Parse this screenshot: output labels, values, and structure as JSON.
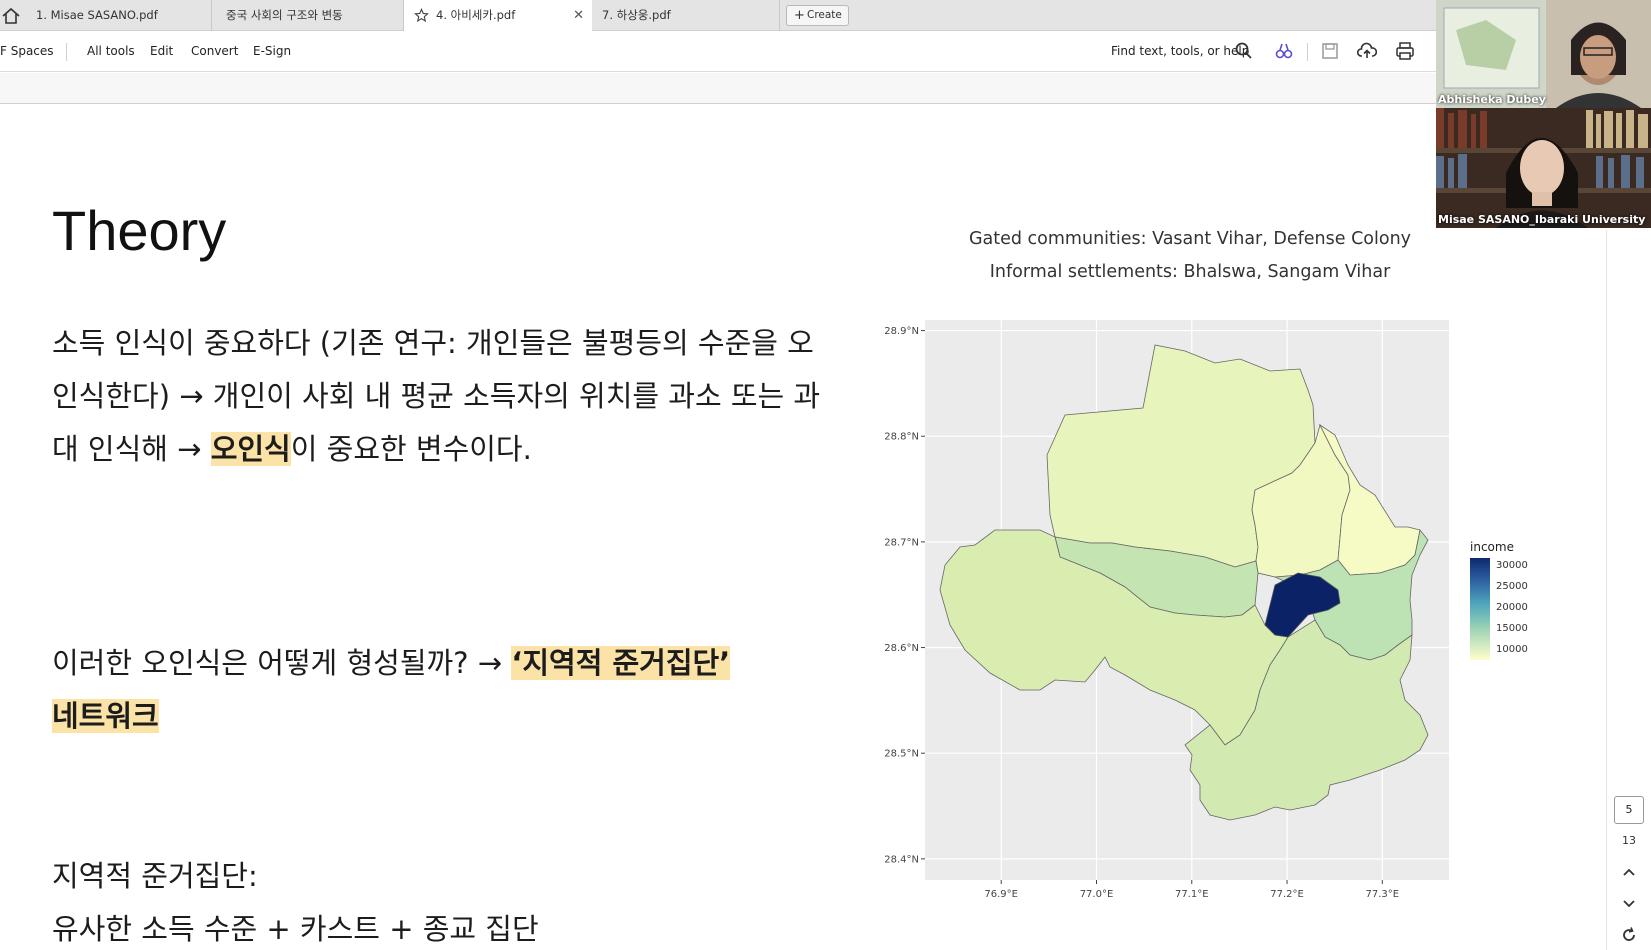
{
  "tabs": [
    {
      "label": "1. Misae SASANO.pdf",
      "active": false
    },
    {
      "label": "중국 사회의 구조와 변동",
      "active": false
    },
    {
      "label": "4. 아비세카.pdf",
      "active": true
    },
    {
      "label": "7. 하상웅.pdf",
      "active": false
    }
  ],
  "create_label": "Create",
  "toolbar": {
    "spaces": "F Spaces",
    "all_tools": "All tools",
    "edit": "Edit",
    "convert": "Convert",
    "esign": "E-Sign",
    "search_label": "Find text, tools, or help"
  },
  "slide": {
    "title": "Theory",
    "p1": {
      "a": "소득 인식이 중요하다 (기존 연구: 개인들은 불평등의 수준을 오인식한다) → 개인이 사회 내 평균 소득자의 위치를 과소 또는 과대 인식해 → ",
      "hl": "오인식",
      "b": "이 중요한 변수이다."
    },
    "p2": {
      "a": "이러한 오인식은 어떻게 형성될까? → ",
      "hl1": "‘지역적 준거집단’",
      "hl2": "네트워크"
    },
    "p3": {
      "l1": "지역적 준거집단:",
      "l2": "유사한 소득 수준 + 카스트 + 종교 집단"
    },
    "caption1": "Gated communities: Vasant Vihar, Defense Colony",
    "caption2": "Informal settlements: Bhalswa, Sangam Vihar"
  },
  "chart_data": {
    "type": "choropleth",
    "y_ticks": [
      "28.9°N",
      "28.8°N",
      "28.7°N",
      "28.6°N",
      "28.5°N",
      "28.4°N"
    ],
    "x_ticks": [
      "76.9°E",
      "77.0°E",
      "77.1°E",
      "77.2°E",
      "77.3°E"
    ],
    "y_values": [
      28.9,
      28.8,
      28.7,
      28.6,
      28.5,
      28.4
    ],
    "x_values": [
      76.9,
      77.0,
      77.1,
      77.2,
      77.3
    ],
    "xlim": [
      76.82,
      77.37
    ],
    "ylim": [
      28.38,
      28.91
    ],
    "legend_title": "income",
    "legend_ticks": [
      "30000",
      "25000",
      "20000",
      "15000",
      "10000"
    ],
    "legend_values": [
      30000,
      25000,
      20000,
      15000,
      10000
    ],
    "colors": {
      "low": "#ffffcc",
      "high": "#0c2266",
      "panel": "#ebebeb",
      "grid": "#ffffff"
    },
    "regions": [
      {
        "income": 10500
      },
      {
        "income": 9500
      },
      {
        "income": 9000
      },
      {
        "income": 13500
      },
      {
        "income": 12000
      },
      {
        "income": 14000
      },
      {
        "income": 12500
      },
      {
        "income": 32000
      }
    ]
  },
  "video": {
    "p1_name": "Abhisheka Dubey",
    "p2_name": "Misae SASANO_Ibaraki University"
  },
  "pager": {
    "current": "5",
    "total": "13"
  }
}
